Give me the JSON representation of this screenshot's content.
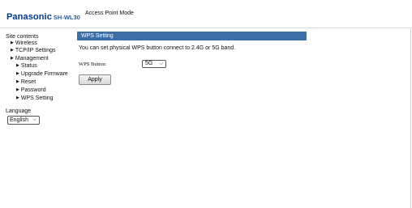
{
  "header": {
    "brand_name": "Panasonic",
    "brand_model": "SH-WL30",
    "mode_title": "Access Point Mode"
  },
  "sidebar": {
    "heading": "Site contents",
    "items": [
      {
        "label": "Wireless",
        "level": 1
      },
      {
        "label": "TCP/IP Settings",
        "level": 1
      },
      {
        "label": "Management",
        "level": 1
      },
      {
        "label": "Status",
        "level": 2
      },
      {
        "label": "Upgrade Firmware",
        "level": 2
      },
      {
        "label": "Reset",
        "level": 2
      },
      {
        "label": "Password",
        "level": 2
      },
      {
        "label": "WPS Setting",
        "level": 2
      }
    ],
    "language_heading": "Language",
    "language_value": "English"
  },
  "main": {
    "section_title": "WPS Setting",
    "description": "You can set physical WPS button connect to 2.4G or 5G band.",
    "wps_label": "WPS Button:",
    "wps_value": "5G",
    "apply_label": "Apply"
  },
  "colors": {
    "brand": "#003b8c",
    "section_header": "#3c6ea8"
  }
}
